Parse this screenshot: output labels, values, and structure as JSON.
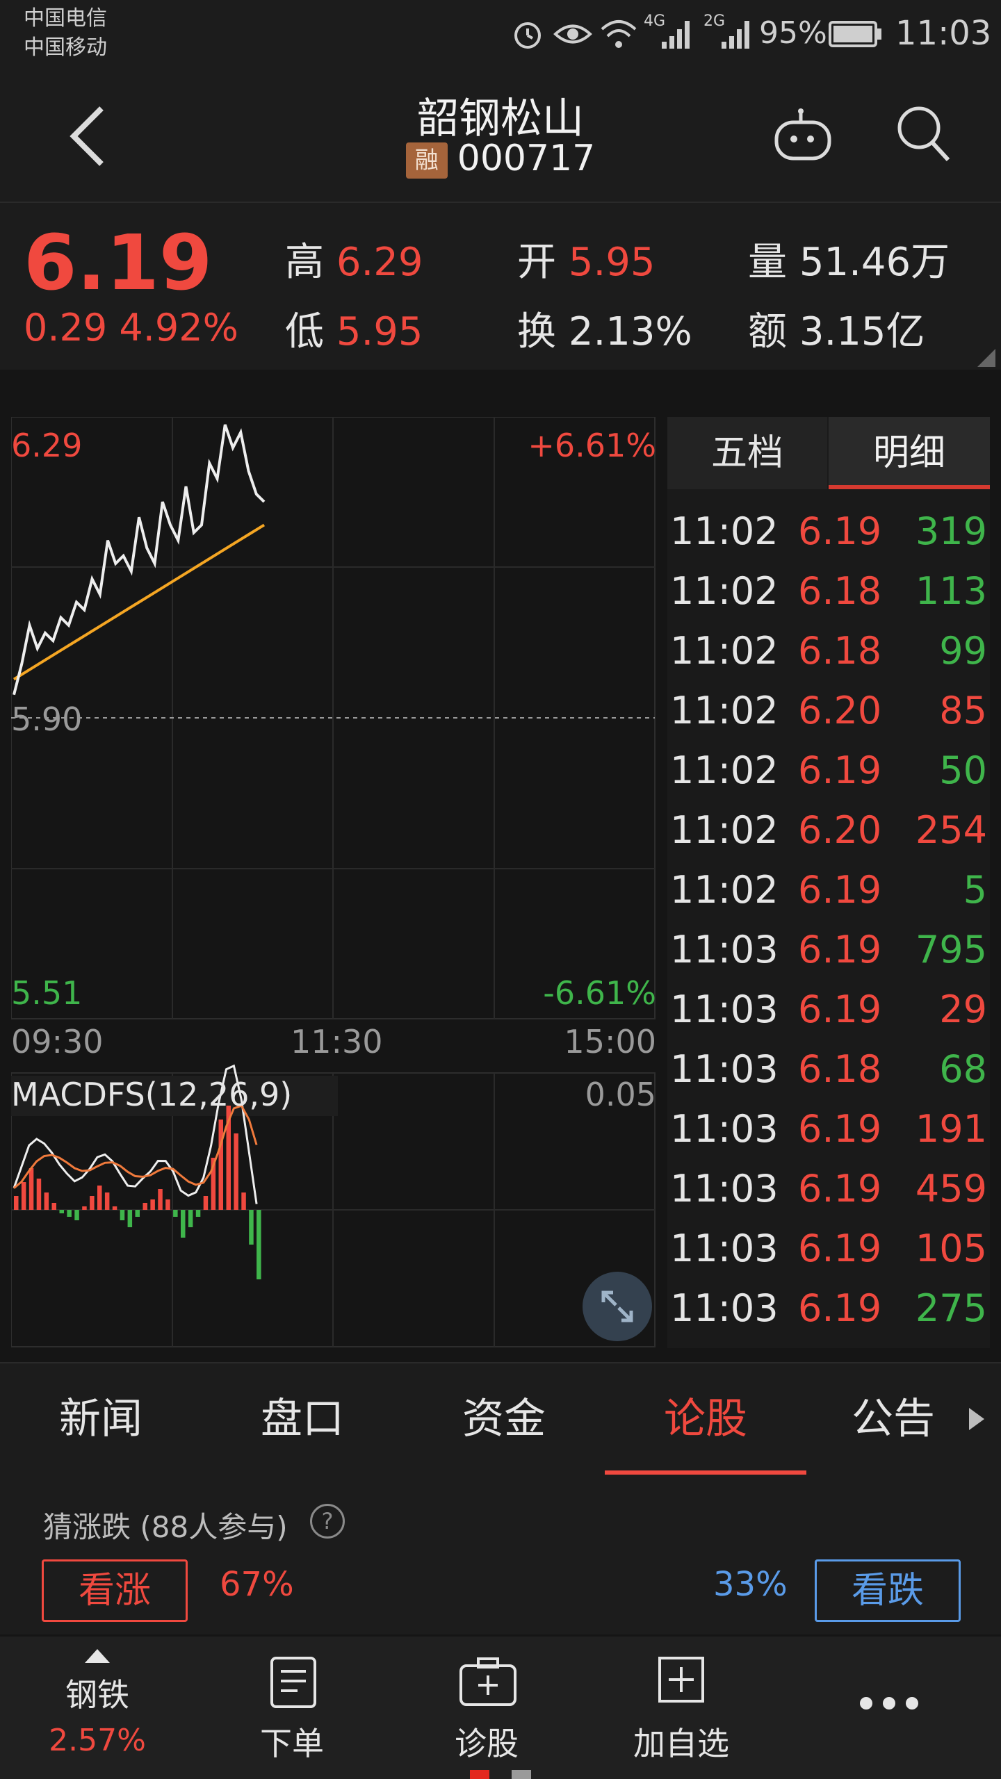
{
  "status": {
    "carrier1": "中国电信",
    "carrier2": "中国移动",
    "net1": "4G",
    "net2": "2G",
    "battery": "95%",
    "time": "11:03"
  },
  "header": {
    "name": "韶钢松山",
    "badge": "融",
    "code": "000717"
  },
  "quote": {
    "price": "6.19",
    "change": "0.29",
    "change_pct": "4.92%",
    "high_label": "高",
    "high": "6.29",
    "low_label": "低",
    "low": "5.95",
    "open_label": "开",
    "open": "5.95",
    "turnover_label": "换",
    "turnover": "2.13%",
    "volume_label": "量",
    "volume": "51.46万",
    "amount_label": "额",
    "amount": "3.15亿"
  },
  "chart": {
    "y_top": "6.29",
    "y_top_pct": "+6.61%",
    "y_mid": "5.90",
    "y_bot": "5.51",
    "y_bot_pct": "-6.61%",
    "x_start": "09:30",
    "x_mid": "11:30",
    "x_end": "15:00",
    "macd_label": "MACDFS(12,26,9)",
    "macd_max": "0.05"
  },
  "chart_data": {
    "type": "line",
    "ylim": [
      5.51,
      6.29
    ],
    "series": [],
    "x": [
      "09:30",
      "11:30",
      "15:00"
    ],
    "price_path": [
      5.93,
      5.97,
      6.02,
      5.99,
      6.01,
      6.0,
      6.03,
      6.02,
      6.05,
      6.04,
      6.08,
      6.06,
      6.13,
      6.1,
      6.11,
      6.09,
      6.16,
      6.12,
      6.1,
      6.18,
      6.15,
      6.13,
      6.2,
      6.14,
      6.15,
      6.23,
      6.21,
      6.28,
      6.25,
      6.27,
      6.22,
      6.19,
      6.18
    ],
    "avg_path": [
      5.95,
      5.96,
      5.97,
      5.98,
      5.99,
      6.0,
      6.01,
      6.02,
      6.03,
      6.04,
      6.05,
      6.06,
      6.07,
      6.08,
      6.09,
      6.1,
      6.11,
      6.12,
      6.13,
      6.14,
      6.15
    ],
    "macd_bars": [
      0.4,
      0.8,
      1.2,
      0.9,
      0.5,
      0.2,
      -0.1,
      -0.2,
      -0.3,
      0.1,
      0.4,
      0.7,
      0.5,
      0.1,
      -0.3,
      -0.5,
      -0.2,
      0.2,
      0.3,
      0.6,
      0.3,
      -0.2,
      -0.8,
      -0.5,
      -0.2,
      0.4,
      1.5,
      2.6,
      3.0,
      2.2,
      0.5,
      -1.0,
      -2.0
    ]
  },
  "detail": {
    "tab1": "五档",
    "tab2": "明细",
    "rows": [
      {
        "t": "11:02",
        "p": "6.19",
        "v": "319",
        "c": "green"
      },
      {
        "t": "11:02",
        "p": "6.18",
        "v": "113",
        "c": "green"
      },
      {
        "t": "11:02",
        "p": "6.18",
        "v": "99",
        "c": "green"
      },
      {
        "t": "11:02",
        "p": "6.20",
        "v": "85",
        "c": "red"
      },
      {
        "t": "11:02",
        "p": "6.19",
        "v": "50",
        "c": "green"
      },
      {
        "t": "11:02",
        "p": "6.20",
        "v": "254",
        "c": "red"
      },
      {
        "t": "11:02",
        "p": "6.19",
        "v": "5",
        "c": "green"
      },
      {
        "t": "11:03",
        "p": "6.19",
        "v": "795",
        "c": "green"
      },
      {
        "t": "11:03",
        "p": "6.19",
        "v": "29",
        "c": "red"
      },
      {
        "t": "11:03",
        "p": "6.18",
        "v": "68",
        "c": "green"
      },
      {
        "t": "11:03",
        "p": "6.19",
        "v": "191",
        "c": "red"
      },
      {
        "t": "11:03",
        "p": "6.19",
        "v": "459",
        "c": "red"
      },
      {
        "t": "11:03",
        "p": "6.19",
        "v": "105",
        "c": "red"
      },
      {
        "t": "11:03",
        "p": "6.19",
        "v": "275",
        "c": "green"
      }
    ]
  },
  "tabs": [
    "新闻",
    "盘口",
    "资金",
    "论股",
    "公告"
  ],
  "vote": {
    "title": "猜涨跌",
    "participants": "(88人参与)",
    "help": "?",
    "up_label": "看涨",
    "up_pct": "67%",
    "down_pct": "33%",
    "down_label": "看跌"
  },
  "bottom": {
    "sector": "钢铁",
    "sector_pct": "2.57%",
    "order": "下单",
    "diagnose": "诊股",
    "add": "加自选"
  },
  "colors": {
    "red": "#f0493f",
    "green": "#3fb54b",
    "blue": "#5a9be8",
    "orange": "#f5a623"
  }
}
